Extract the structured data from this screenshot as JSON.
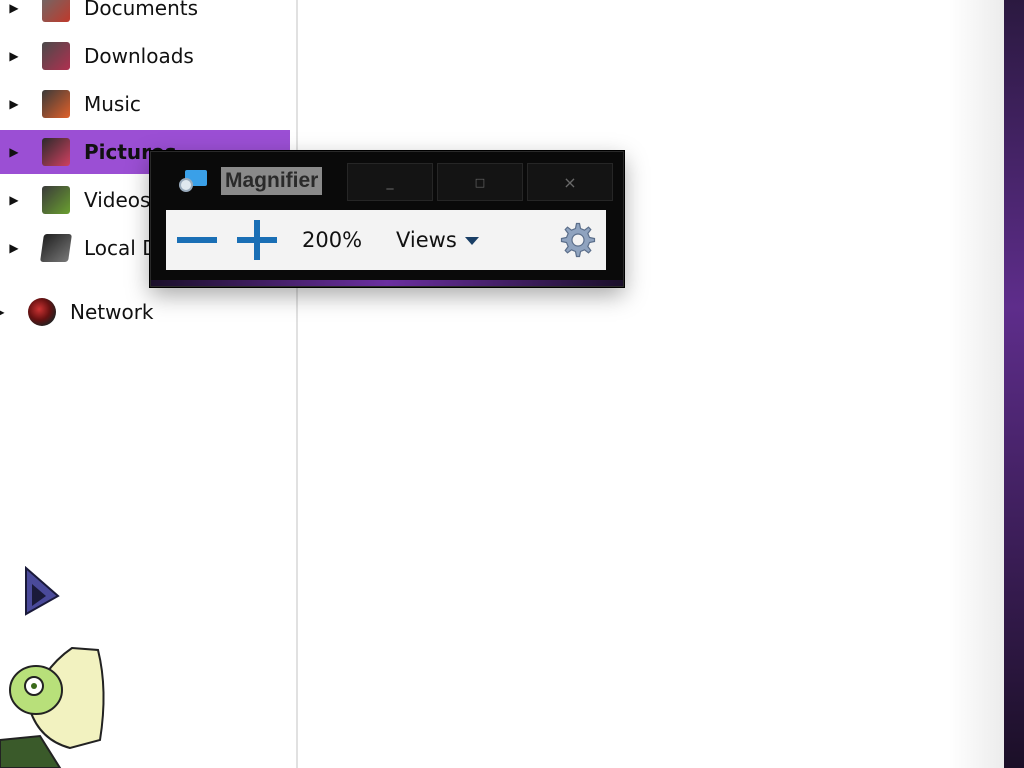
{
  "nav": {
    "items": [
      {
        "label": "Documents",
        "icon": "documents-folder-icon",
        "selected": false
      },
      {
        "label": "Downloads",
        "icon": "downloads-folder-icon",
        "selected": false
      },
      {
        "label": "Music",
        "icon": "music-folder-icon",
        "selected": false
      },
      {
        "label": "Pictures",
        "icon": "pictures-folder-icon",
        "selected": true
      },
      {
        "label": "Videos",
        "icon": "videos-folder-icon",
        "selected": false
      },
      {
        "label": "Local D",
        "icon": "local-disk-icon",
        "selected": false
      }
    ],
    "network_label": "Network"
  },
  "magnifier": {
    "title": "Magnifier",
    "minimize_glyph": "_",
    "maximize_glyph": "□",
    "close_glyph": "×",
    "zoom_level": "200%",
    "views_label": "Views"
  },
  "colors": {
    "selection": "#9b4fd4",
    "zoom_blue": "#1a6fb5",
    "window_frame": "#0a0a0a"
  }
}
